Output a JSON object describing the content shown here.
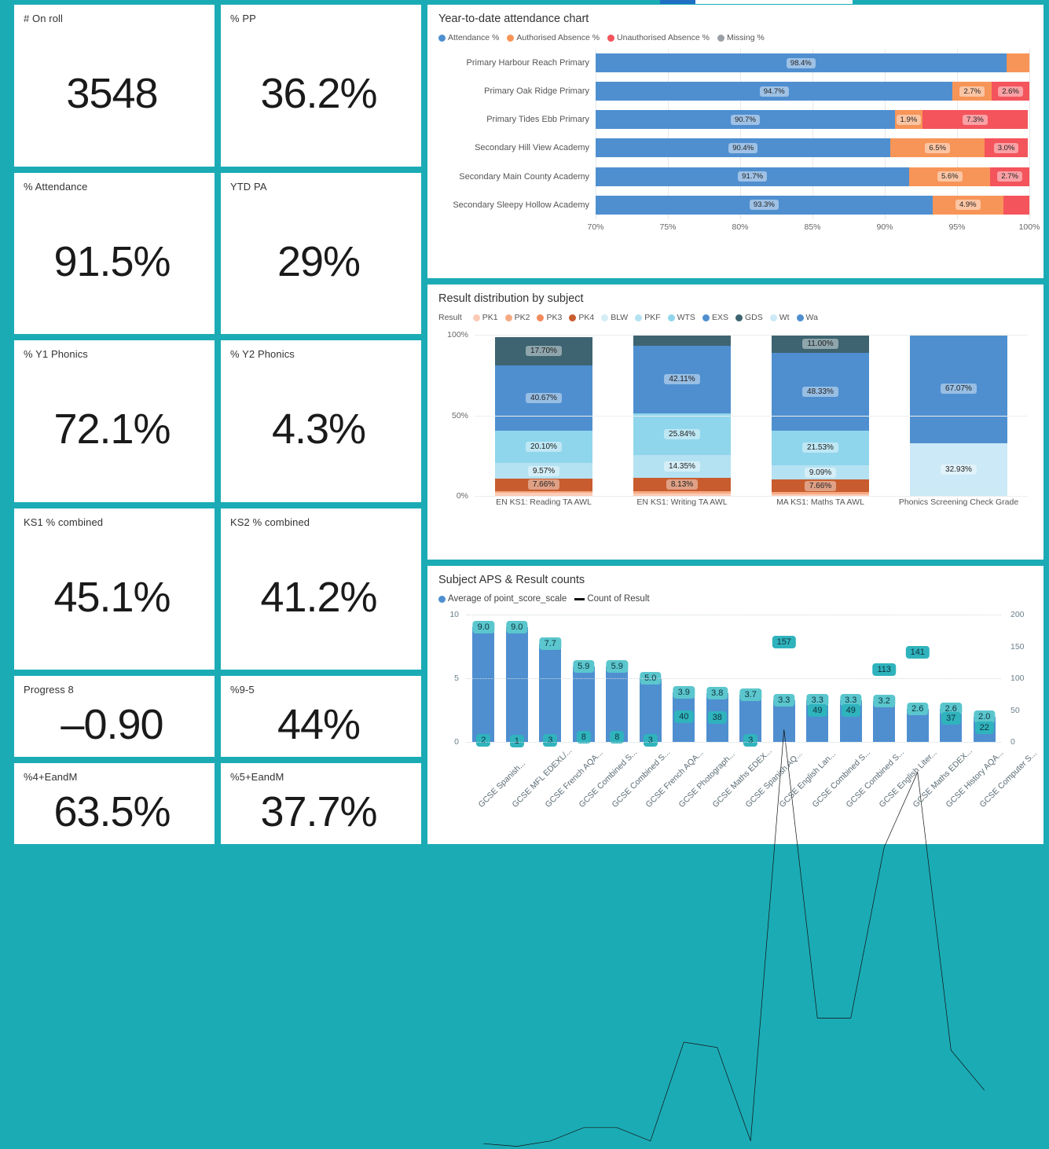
{
  "theme": {
    "background": "#1babb5",
    "card": "#ffffff",
    "accent_blue": "#4f8fd0",
    "accent_teal": "#2fb3bd"
  },
  "kpis": [
    {
      "title": "# On roll",
      "value": "3548"
    },
    {
      "title": "% PP",
      "value": "36.2%"
    },
    {
      "title": "% Attendance",
      "value": "91.5%"
    },
    {
      "title": "YTD PA",
      "value": "29%"
    },
    {
      "title": "% Y1 Phonics",
      "value": "72.1%"
    },
    {
      "title": "% Y2 Phonics",
      "value": "4.3%"
    },
    {
      "title": "KS1 % combined",
      "value": "45.1%"
    },
    {
      "title": "KS2 % combined",
      "value": "41.2%"
    },
    {
      "title": "Progress 8",
      "value": "–0.90"
    },
    {
      "title": "%9-5",
      "value": "44%"
    },
    {
      "title": "%4+EandM",
      "value": "63.5%"
    },
    {
      "title": "%5+EandM",
      "value": "37.7%"
    }
  ],
  "attendance_panel": {
    "title": "Year-to-date attendance chart"
  },
  "result_panel": {
    "title": "Result distribution by subject",
    "legend_prefix": "Result"
  },
  "aps_panel": {
    "title": "Subject APS & Result counts"
  },
  "chart_data": [
    {
      "type": "bar",
      "orientation": "horizontal",
      "stacked": true,
      "title": "Year-to-date attendance chart",
      "xlabel": "",
      "ylabel": "",
      "xlim": [
        70,
        100
      ],
      "grid": true,
      "legend_position": "top",
      "xticks": [
        "70%",
        "75%",
        "80%",
        "85%",
        "90%",
        "95%",
        "100%"
      ],
      "legend": [
        {
          "name": "Attendance %",
          "color": "#4f8fd0"
        },
        {
          "name": "Authorised Absence %",
          "color": "#f79558"
        },
        {
          "name": "Unauthorised Absence %",
          "color": "#f4545c"
        },
        {
          "name": "Missing %",
          "color": "#9aa0a6"
        }
      ],
      "categories": [
        "Primary Harbour Reach Primary",
        "Primary Oak Ridge Primary",
        "Primary Tides Ebb Primary",
        "Secondary Hill View Academy",
        "Secondary Main County Academy",
        "Secondary Sleepy Hollow Academy"
      ],
      "series": [
        {
          "name": "Attendance %",
          "values": [
            98.4,
            94.7,
            90.7,
            90.4,
            91.7,
            93.3
          ],
          "labels": [
            "98.4%",
            "94.7%",
            "90.7%",
            "90.4%",
            "91.7%",
            "93.3%"
          ]
        },
        {
          "name": "Authorised Absence %",
          "values": [
            1.6,
            2.7,
            1.9,
            6.5,
            5.6,
            4.9
          ],
          "labels": [
            "",
            "2.7%",
            "1.9%",
            "6.5%",
            "5.6%",
            "4.9%"
          ]
        },
        {
          "name": "Unauthorised Absence %",
          "values": [
            0.0,
            2.6,
            7.3,
            3.0,
            2.7,
            1.8
          ],
          "labels": [
            "",
            "2.6%",
            "7.3%",
            "3.0%",
            "2.7%",
            ""
          ]
        },
        {
          "name": "Missing %",
          "values": [
            0.0,
            0.0,
            0.0,
            0.0,
            0.0,
            0.0
          ],
          "labels": [
            "",
            "",
            "",
            "",
            "",
            ""
          ]
        }
      ]
    },
    {
      "type": "bar",
      "orientation": "vertical",
      "stacked": true,
      "title": "Result distribution by subject",
      "xlabel": "",
      "ylabel": "",
      "ylim": [
        0,
        100
      ],
      "yticks": [
        "0%",
        "50%",
        "100%"
      ],
      "grid": true,
      "legend_position": "top",
      "legend": [
        {
          "name": "PK1",
          "color": "#fbcbb6"
        },
        {
          "name": "PK2",
          "color": "#f6a982"
        },
        {
          "name": "PK3",
          "color": "#f18a5c"
        },
        {
          "name": "PK4",
          "color": "#c85c2e"
        },
        {
          "name": "BLW",
          "color": "#d4edf7"
        },
        {
          "name": "PKF",
          "color": "#b5e2f2"
        },
        {
          "name": "WTS",
          "color": "#8fd6ec"
        },
        {
          "name": "EXS",
          "color": "#4f8fd0"
        },
        {
          "name": "GDS",
          "color": "#3d6470"
        },
        {
          "name": "Wt",
          "color": "#cbe9f6"
        },
        {
          "name": "Wa",
          "color": "#4f8fd0"
        }
      ],
      "categories": [
        "EN KS1: Reading TA AWL",
        "EN KS1: Writing TA AWL",
        "MA KS1: Maths TA AWL",
        "Phonics Screening Check Grade"
      ],
      "stacks": [
        {
          "category": "EN KS1: Reading TA AWL",
          "segments": [
            {
              "name": "PK1",
              "value": 1.9,
              "label": "",
              "color": "#fbcbb6"
            },
            {
              "name": "PK2",
              "value": 1.2,
              "label": "",
              "color": "#f6a982"
            },
            {
              "name": "PK4",
              "value": 7.66,
              "label": "7.66%",
              "color": "#c85c2e"
            },
            {
              "name": "BLW",
              "value": 9.57,
              "label": "9.57%",
              "color": "#b5e2f2"
            },
            {
              "name": "WTS",
              "value": 20.1,
              "label": "20.10%",
              "color": "#8fd6ec"
            },
            {
              "name": "EXS",
              "value": 40.67,
              "label": "40.67%",
              "color": "#4f8fd0"
            },
            {
              "name": "GDS",
              "value": 17.7,
              "label": "17.70%",
              "color": "#3d6470"
            }
          ]
        },
        {
          "category": "EN KS1: Writing TA AWL",
          "segments": [
            {
              "name": "PK1",
              "value": 1.7,
              "label": "",
              "color": "#fbcbb6"
            },
            {
              "name": "PK2",
              "value": 1.3,
              "label": "",
              "color": "#f6a982"
            },
            {
              "name": "PK4",
              "value": 8.13,
              "label": "8.13%",
              "color": "#c85c2e"
            },
            {
              "name": "BLW",
              "value": 14.35,
              "label": "14.35%",
              "color": "#b5e2f2"
            },
            {
              "name": "WTS",
              "value": 25.84,
              "label": "25.84%",
              "color": "#8fd6ec"
            },
            {
              "name": "EXS",
              "value": 42.11,
              "label": "42.11%",
              "color": "#4f8fd0"
            },
            {
              "name": "GDS",
              "value": 6.57,
              "label": "",
              "color": "#3d6470"
            }
          ]
        },
        {
          "category": "MA KS1: Maths TA AWL",
          "segments": [
            {
              "name": "PK1",
              "value": 1.1,
              "label": "",
              "color": "#fbcbb6"
            },
            {
              "name": "PK2",
              "value": 1.3,
              "label": "",
              "color": "#f6a982"
            },
            {
              "name": "PK4",
              "value": 7.66,
              "label": "7.66%",
              "color": "#c85c2e"
            },
            {
              "name": "BLW",
              "value": 9.09,
              "label": "9.09%",
              "color": "#b5e2f2"
            },
            {
              "name": "WTS",
              "value": 21.53,
              "label": "21.53%",
              "color": "#8fd6ec"
            },
            {
              "name": "EXS",
              "value": 48.33,
              "label": "48.33%",
              "color": "#4f8fd0"
            },
            {
              "name": "GDS",
              "value": 11.0,
              "label": "11.00%",
              "color": "#3d6470"
            }
          ]
        },
        {
          "category": "Phonics Screening Check Grade",
          "segments": [
            {
              "name": "Wt",
              "value": 32.93,
              "label": "32.93%",
              "color": "#cbe9f6"
            },
            {
              "name": "Wa",
              "value": 67.07,
              "label": "67.07%",
              "color": "#4f8fd0"
            }
          ]
        }
      ]
    },
    {
      "type": "bar",
      "combo": "line",
      "title": "Subject APS & Result counts",
      "xlabel": "",
      "ylabel": "",
      "ylim": [
        0,
        10
      ],
      "y2lim": [
        0,
        200
      ],
      "yticks": [
        "0",
        "5",
        "10"
      ],
      "y2ticks": [
        "0",
        "50",
        "100",
        "150",
        "200"
      ],
      "grid": true,
      "legend_position": "top",
      "legend": [
        {
          "name": "Average of point_score_scale",
          "color": "#4f8fd0",
          "marker": "dot"
        },
        {
          "name": "Count of Result",
          "color": "#111111",
          "marker": "line"
        }
      ],
      "categories": [
        "GCSE Spanish...",
        "GCSE MFL EDEXL/...",
        "GCSE French AQA...",
        "GCSE Combined S...",
        "GCSE Combined S...",
        "GCSE French AQA...",
        "GCSE Photograph...",
        "GCSE Maths EDEX...",
        "GCSE Spanish AQ...",
        "GCSE English Lan...",
        "GCSE Combined S...",
        "GCSE Combined S...",
        "GCSE English Liter...",
        "GCSE Maths EDEX...",
        "GCSE History AQA...",
        "GCSE Computer S..."
      ],
      "series": [
        {
          "name": "Average of point_score_scale",
          "axis": "left",
          "values": [
            9.0,
            9.0,
            7.7,
            5.9,
            5.9,
            5.0,
            3.9,
            3.8,
            3.7,
            3.3,
            3.3,
            3.3,
            3.2,
            2.6,
            2.6,
            2.0
          ],
          "labels": [
            "9.0",
            "9.0",
            "7.7",
            "5.9",
            "5.9",
            "5.0",
            "3.9",
            "3.8",
            "3.7",
            "3.3",
            "3.3",
            "3.3",
            "3.2",
            "2.6",
            "2.6",
            "2.0"
          ]
        },
        {
          "name": "Count of Result",
          "axis": "right",
          "values": [
            2,
            1,
            3,
            8,
            8,
            3,
            40,
            38,
            3,
            157,
            49,
            49,
            113,
            141,
            37,
            22
          ],
          "labels": [
            "2",
            "1",
            "3",
            "8",
            "8",
            "3",
            "40",
            "38",
            "3",
            "157",
            "49",
            "49",
            "113",
            "141",
            "37",
            "22"
          ]
        }
      ]
    }
  ]
}
